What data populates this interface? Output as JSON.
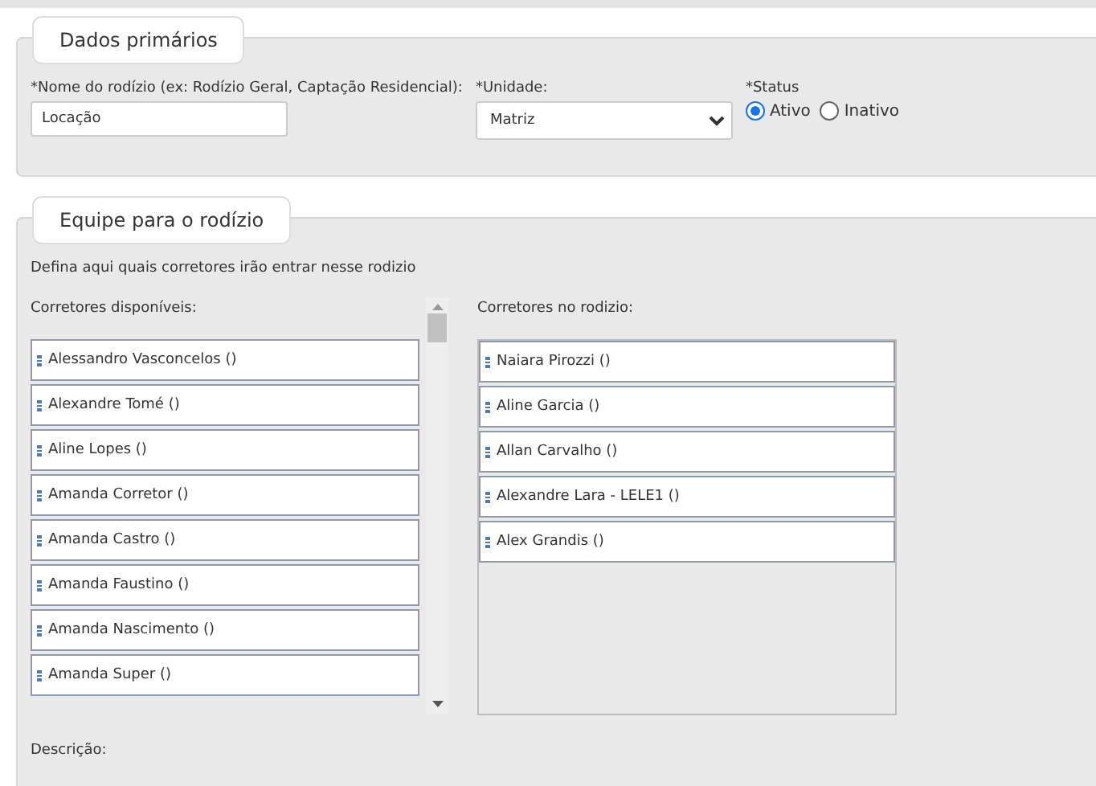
{
  "primary": {
    "title": "Dados primários",
    "name_field": {
      "label": "*Nome do rodízio (ex: Rodízio Geral, Captação Residencial):",
      "value": "Locação"
    },
    "unit_field": {
      "label": "*Unidade:",
      "value": "Matriz"
    },
    "status": {
      "label": "*Status",
      "options": [
        {
          "label": "Ativo",
          "selected": true
        },
        {
          "label": "Inativo",
          "selected": false
        }
      ]
    }
  },
  "team": {
    "title": "Equipe para o rodízio",
    "hint": "Defina aqui quais corretores irão entrar nesse rodizio",
    "available": {
      "label": "Corretores disponíveis:",
      "items": [
        "Alessandro Vasconcelos ()",
        "Alexandre Tomé ()",
        "Aline Lopes ()",
        "Amanda Corretor ()",
        "Amanda Castro ()",
        "Amanda Faustino ()",
        "Amanda Nascimento ()",
        "Amanda Super ()"
      ]
    },
    "assigned": {
      "label": "Corretores no rodizio:",
      "items": [
        "Naiara Pirozzi ()",
        "Aline Garcia ()",
        "Allan Carvalho ()",
        "Alexandre Lara - LELE1 ()",
        "Alex Grandis ()"
      ]
    },
    "description_label": "Descrição:"
  }
}
